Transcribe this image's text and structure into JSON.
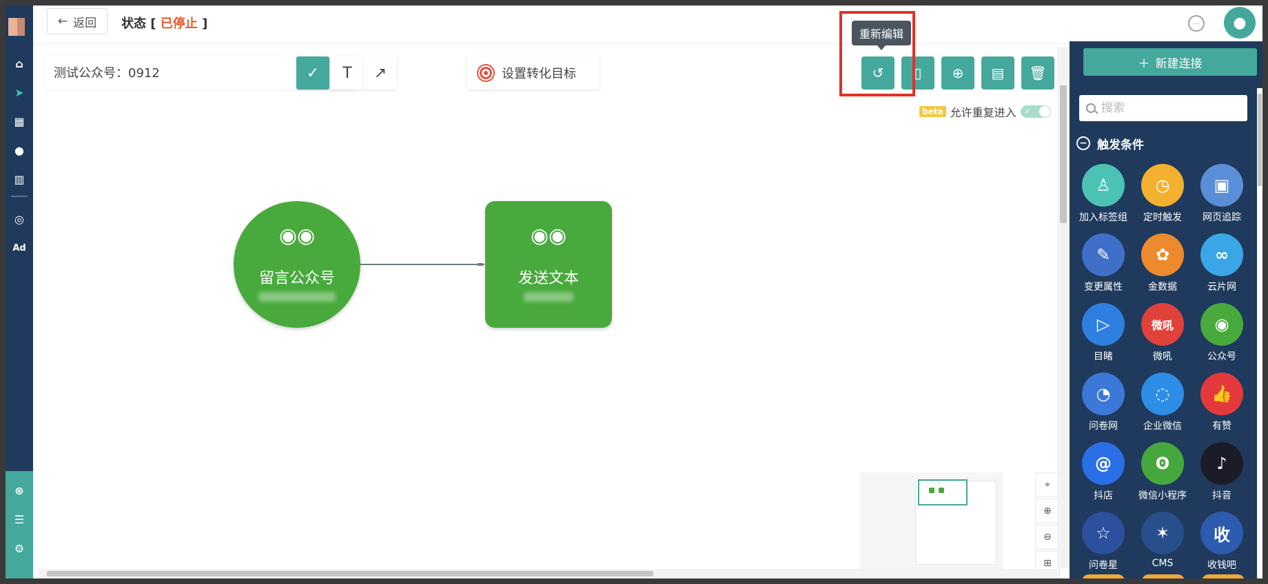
{
  "topbar": {
    "back_label": "返回",
    "status_prefix": "状态 [",
    "status_value": "已停止",
    "status_suffix": "]"
  },
  "toolbar": {
    "name_value": "测试公众号：0912",
    "goal_label": "设置转化目标",
    "tooltip": "重新编辑",
    "beta_badge": "beta",
    "reentry_label": "允许重复进入"
  },
  "canvas": {
    "nodes": [
      {
        "label": "留言公众号",
        "shape": "circle"
      },
      {
        "label": "发送文本",
        "shape": "rect"
      }
    ]
  },
  "panel": {
    "new_connection": "新建连接",
    "search_placeholder": "搜索",
    "section_title": "触发条件",
    "items": [
      {
        "label": "加入标签组",
        "color": "#4cc2b4",
        "icon": "user-plus-icon",
        "glyph": "♙"
      },
      {
        "label": "定时触发",
        "color": "#f3b12f",
        "icon": "clock-icon",
        "glyph": "◷"
      },
      {
        "label": "网页追踪",
        "color": "#5a8fd8",
        "icon": "webpage-icon",
        "glyph": "▣"
      },
      {
        "label": "变更属性",
        "color": "#3f6fc9",
        "icon": "edit-icon",
        "glyph": "✎"
      },
      {
        "label": "金数据",
        "color": "#ee8a2e",
        "icon": "jinshuju-icon",
        "glyph": "✿"
      },
      {
        "label": "云片网",
        "color": "#3aa6e8",
        "icon": "yunpian-icon",
        "glyph": "∞"
      },
      {
        "label": "目睹",
        "color": "#2f7fe0",
        "icon": "play-icon",
        "glyph": "▷"
      },
      {
        "label": "微吼",
        "color": "#e0413a",
        "icon": "vhall-icon",
        "glyph": "微吼"
      },
      {
        "label": "公众号",
        "color": "#48aa3c",
        "icon": "wechat-icon",
        "glyph": "◉"
      },
      {
        "label": "问卷网",
        "color": "#3c78d8",
        "icon": "wenjuan-icon",
        "glyph": "◔"
      },
      {
        "label": "企业微信",
        "color": "#2d8ee6",
        "icon": "wecom-icon",
        "glyph": "◌"
      },
      {
        "label": "有赞",
        "color": "#e4393c",
        "icon": "thumbs-up-icon",
        "glyph": "👍"
      },
      {
        "label": "抖店",
        "color": "#2b6fe8",
        "icon": "doudian-icon",
        "glyph": "@"
      },
      {
        "label": "微信小程序",
        "color": "#46a83c",
        "icon": "miniprogram-icon",
        "glyph": "ʘ"
      },
      {
        "label": "抖音",
        "color": "#1c1c28",
        "icon": "douyin-icon",
        "glyph": "♪"
      },
      {
        "label": "问卷星",
        "color": "#2c4f9e",
        "icon": "star-icon",
        "glyph": "☆"
      },
      {
        "label": "CMS",
        "color": "#274f8c",
        "icon": "cms-icon",
        "glyph": "✶"
      },
      {
        "label": "收钱吧",
        "color": "#2d5bb0",
        "icon": "shouqianba-icon",
        "glyph": "收"
      }
    ]
  },
  "colors": {
    "accent": "#45a89c",
    "nav_bg": "#1f3a5c",
    "node_green": "#48aa3c",
    "stopped": "#e65a2c",
    "highlight": "#e0312a"
  }
}
